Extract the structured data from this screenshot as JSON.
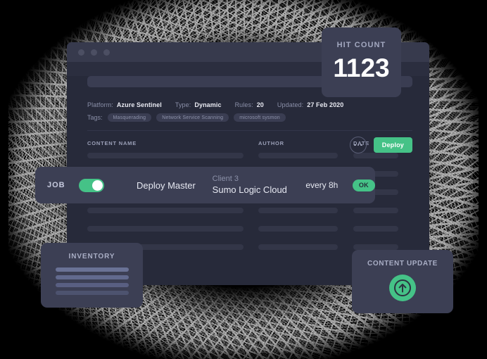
{
  "window": {
    "traffic_lights": [
      "window-dot-1",
      "window-dot-2",
      "window-dot-3"
    ],
    "search_placeholder": ""
  },
  "detail": {
    "meta": [
      {
        "label": "Platform:",
        "value": "Azure Sentinel"
      },
      {
        "label": "Type:",
        "value": "Dynamic"
      },
      {
        "label": "Rules:",
        "value": "20"
      },
      {
        "label": "Updated:",
        "value": "27 Feb 2020"
      }
    ],
    "tags_label": "Tags:",
    "tags": [
      "Masquerading",
      "Network Service Scanning",
      "microsoft sysmon"
    ],
    "more_icon": "ellipsis-icon",
    "deploy_label": "Deploy"
  },
  "table": {
    "columns": [
      "CONTENT NAME",
      "AUTHOR",
      "DATE"
    ],
    "skeleton_row_count": 6
  },
  "hit_count": {
    "label": "HIT COUNT",
    "value": "1123"
  },
  "job": {
    "label": "JOB",
    "toggle_on": true,
    "name": "Deploy Master",
    "client_line1": "Client 3",
    "client_line2": "Sumo Logic Cloud",
    "frequency": "every 8h",
    "status": "OK"
  },
  "inventory": {
    "title": "INVENTORY",
    "bars": 4
  },
  "content_update": {
    "title": "CONTENT UPDATE",
    "icon": "arrow-up-circle-icon"
  },
  "colors": {
    "background": "#000000",
    "window_body": "#272a3a",
    "window_titlebar": "#373a4d",
    "card": "#3c3f54",
    "accent_green": "#45c287",
    "text_primary": "#e9eaf2",
    "text_muted": "#8a8fa8",
    "skeleton": "#333648"
  }
}
